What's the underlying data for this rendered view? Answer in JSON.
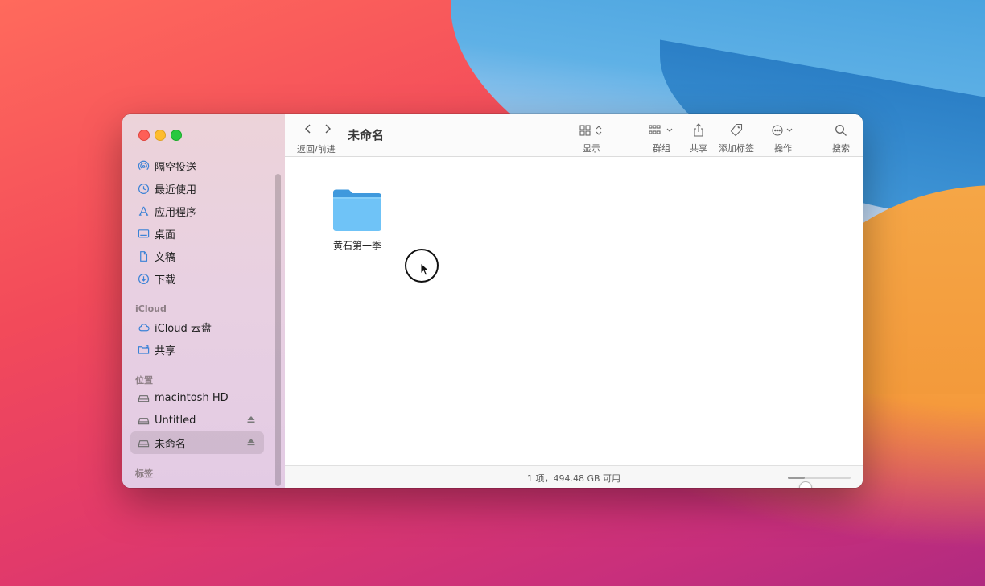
{
  "window": {
    "title": "未命名"
  },
  "toolbar": {
    "nav_label": "返回/前进",
    "view_label": "显示",
    "group_label": "群组",
    "share_label": "共享",
    "tags_label": "添加标签",
    "action_label": "操作",
    "search_label": "搜索"
  },
  "sidebar": {
    "favorites": [
      {
        "label": "隔空投送",
        "icon": "airdrop-icon"
      },
      {
        "label": "最近使用",
        "icon": "clock-icon"
      },
      {
        "label": "应用程序",
        "icon": "applications-icon"
      },
      {
        "label": "桌面",
        "icon": "desktop-icon"
      },
      {
        "label": "文稿",
        "icon": "document-icon"
      },
      {
        "label": "下载",
        "icon": "download-icon"
      }
    ],
    "icloud_title": "iCloud",
    "icloud": [
      {
        "label": "iCloud 云盘",
        "icon": "cloud-icon"
      },
      {
        "label": "共享",
        "icon": "shared-folder-icon"
      }
    ],
    "locations_title": "位置",
    "locations": [
      {
        "label": "macintosh HD",
        "icon": "disk-icon",
        "eject": false
      },
      {
        "label": "Untitled",
        "icon": "disk-icon",
        "eject": true
      },
      {
        "label": "未命名",
        "icon": "disk-icon",
        "eject": true,
        "selected": true
      }
    ],
    "tags_title": "标签"
  },
  "content": {
    "items": [
      {
        "name": "黄石第一季",
        "kind": "folder",
        "icon": "folder-icon"
      }
    ]
  },
  "status": {
    "text": "1 项，494.48 GB 可用",
    "icon_size_fraction": 0.27
  }
}
